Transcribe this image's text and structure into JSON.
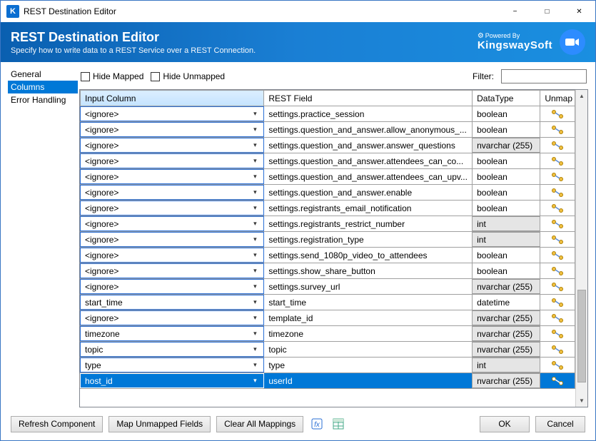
{
  "window": {
    "title": "REST Destination Editor"
  },
  "banner": {
    "heading": "REST Destination Editor",
    "subtitle": "Specify how to write data to a REST Service over a REST Connection.",
    "logo_top": "Powered By",
    "logo_main": "KingswaySoft"
  },
  "sidebar": {
    "items": [
      {
        "label": "General",
        "selected": false
      },
      {
        "label": "Columns",
        "selected": true
      },
      {
        "label": "Error Handling",
        "selected": false
      }
    ]
  },
  "toolbar": {
    "hide_mapped": "Hide Mapped",
    "hide_unmapped": "Hide Unmapped",
    "filter_label": "Filter:",
    "filter_value": ""
  },
  "grid": {
    "headers": {
      "input": "Input Column",
      "rest": "REST Field",
      "datatype": "DataType",
      "unmap": "Unmap"
    },
    "rows": [
      {
        "input": "<ignore>",
        "rest": "settings.practice_session",
        "datatype": "boolean",
        "dt_gray": false,
        "selected": false
      },
      {
        "input": "<ignore>",
        "rest": "settings.question_and_answer.allow_anonymous_...",
        "datatype": "boolean",
        "dt_gray": false,
        "selected": false
      },
      {
        "input": "<ignore>",
        "rest": "settings.question_and_answer.answer_questions",
        "datatype": "nvarchar (255)",
        "dt_gray": true,
        "selected": false
      },
      {
        "input": "<ignore>",
        "rest": "settings.question_and_answer.attendees_can_co...",
        "datatype": "boolean",
        "dt_gray": false,
        "selected": false
      },
      {
        "input": "<ignore>",
        "rest": "settings.question_and_answer.attendees_can_upv...",
        "datatype": "boolean",
        "dt_gray": false,
        "selected": false
      },
      {
        "input": "<ignore>",
        "rest": "settings.question_and_answer.enable",
        "datatype": "boolean",
        "dt_gray": false,
        "selected": false
      },
      {
        "input": "<ignore>",
        "rest": "settings.registrants_email_notification",
        "datatype": "boolean",
        "dt_gray": false,
        "selected": false
      },
      {
        "input": "<ignore>",
        "rest": "settings.registrants_restrict_number",
        "datatype": "int",
        "dt_gray": true,
        "selected": false
      },
      {
        "input": "<ignore>",
        "rest": "settings.registration_type",
        "datatype": "int",
        "dt_gray": true,
        "selected": false
      },
      {
        "input": "<ignore>",
        "rest": "settings.send_1080p_video_to_attendees",
        "datatype": "boolean",
        "dt_gray": false,
        "selected": false
      },
      {
        "input": "<ignore>",
        "rest": "settings.show_share_button",
        "datatype": "boolean",
        "dt_gray": false,
        "selected": false
      },
      {
        "input": "<ignore>",
        "rest": "settings.survey_url",
        "datatype": "nvarchar (255)",
        "dt_gray": true,
        "selected": false
      },
      {
        "input": "start_time",
        "rest": "start_time",
        "datatype": "datetime",
        "dt_gray": false,
        "selected": false
      },
      {
        "input": "<ignore>",
        "rest": "template_id",
        "datatype": "nvarchar (255)",
        "dt_gray": true,
        "selected": false
      },
      {
        "input": "timezone",
        "rest": "timezone",
        "datatype": "nvarchar (255)",
        "dt_gray": true,
        "selected": false
      },
      {
        "input": "topic",
        "rest": "topic",
        "datatype": "nvarchar (255)",
        "dt_gray": true,
        "selected": false
      },
      {
        "input": "type",
        "rest": "type",
        "datatype": "int",
        "dt_gray": true,
        "selected": false
      },
      {
        "input": "host_id",
        "rest": "userId",
        "datatype": "nvarchar (255)",
        "dt_gray": true,
        "selected": true
      }
    ]
  },
  "footer": {
    "refresh": "Refresh Component",
    "map_unmapped": "Map Unmapped Fields",
    "clear_all": "Clear All Mappings",
    "ok": "OK",
    "cancel": "Cancel"
  }
}
